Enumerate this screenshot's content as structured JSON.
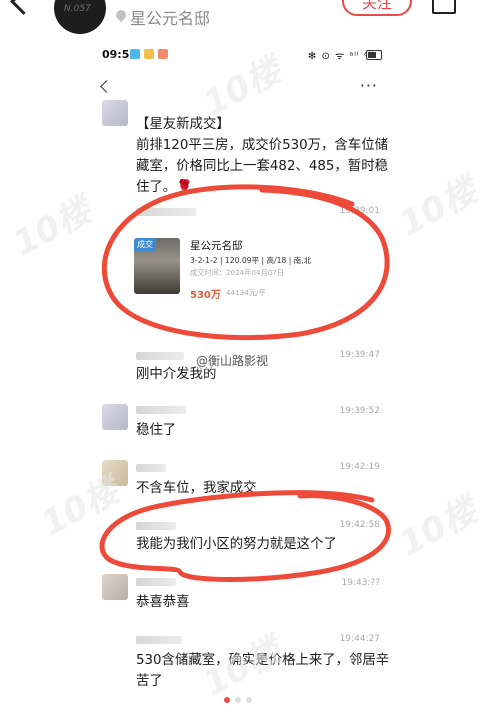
{
  "app": {
    "location": "星公元名邸",
    "follow_label": "关注"
  },
  "phone": {
    "status_time": "09:5",
    "status_right": "✻ ⊙ ᯤ ᵃˡˡ ᵃˡˡ"
  },
  "chat": {
    "messages": [
      {
        "text_lines": [
          "【星友新成交】",
          "前排120平三房，成交价530万，含车位储",
          "藏室，价格同比上一套482、485，暂时稳",
          "住了。🌹"
        ]
      },
      {
        "timestamp": "19:39:01"
      },
      {
        "timestamp": "19:39:47",
        "text": "刚中介发我的"
      },
      {
        "timestamp": "19:39:52",
        "text": "稳住了"
      },
      {
        "timestamp": "19:42:19",
        "text": "不含车位，我家成交"
      },
      {
        "timestamp": "19:42:58",
        "text": "我能为我们小区的努力就是这个了"
      },
      {
        "timestamp": "19:43:??",
        "text": "恭喜恭喜"
      },
      {
        "timestamp": "19:44:27",
        "text_lines": [
          "530含储藏室，确实是价格上来了，邻居辛",
          "苦了"
        ]
      }
    ]
  },
  "deal_card": {
    "tag": "成交",
    "title": "星公元名邸",
    "spec": "3-2-1-2 | 120.09平 | 高/18 | 南,北",
    "date": "成交时间：2024年04月07日",
    "price": "530万",
    "unit_price": "44134元/平"
  },
  "watermark": {
    "weibo": "@衡山路影视"
  },
  "colors": {
    "accent": "#e84a4a",
    "annotation": "#ee4a3a"
  }
}
